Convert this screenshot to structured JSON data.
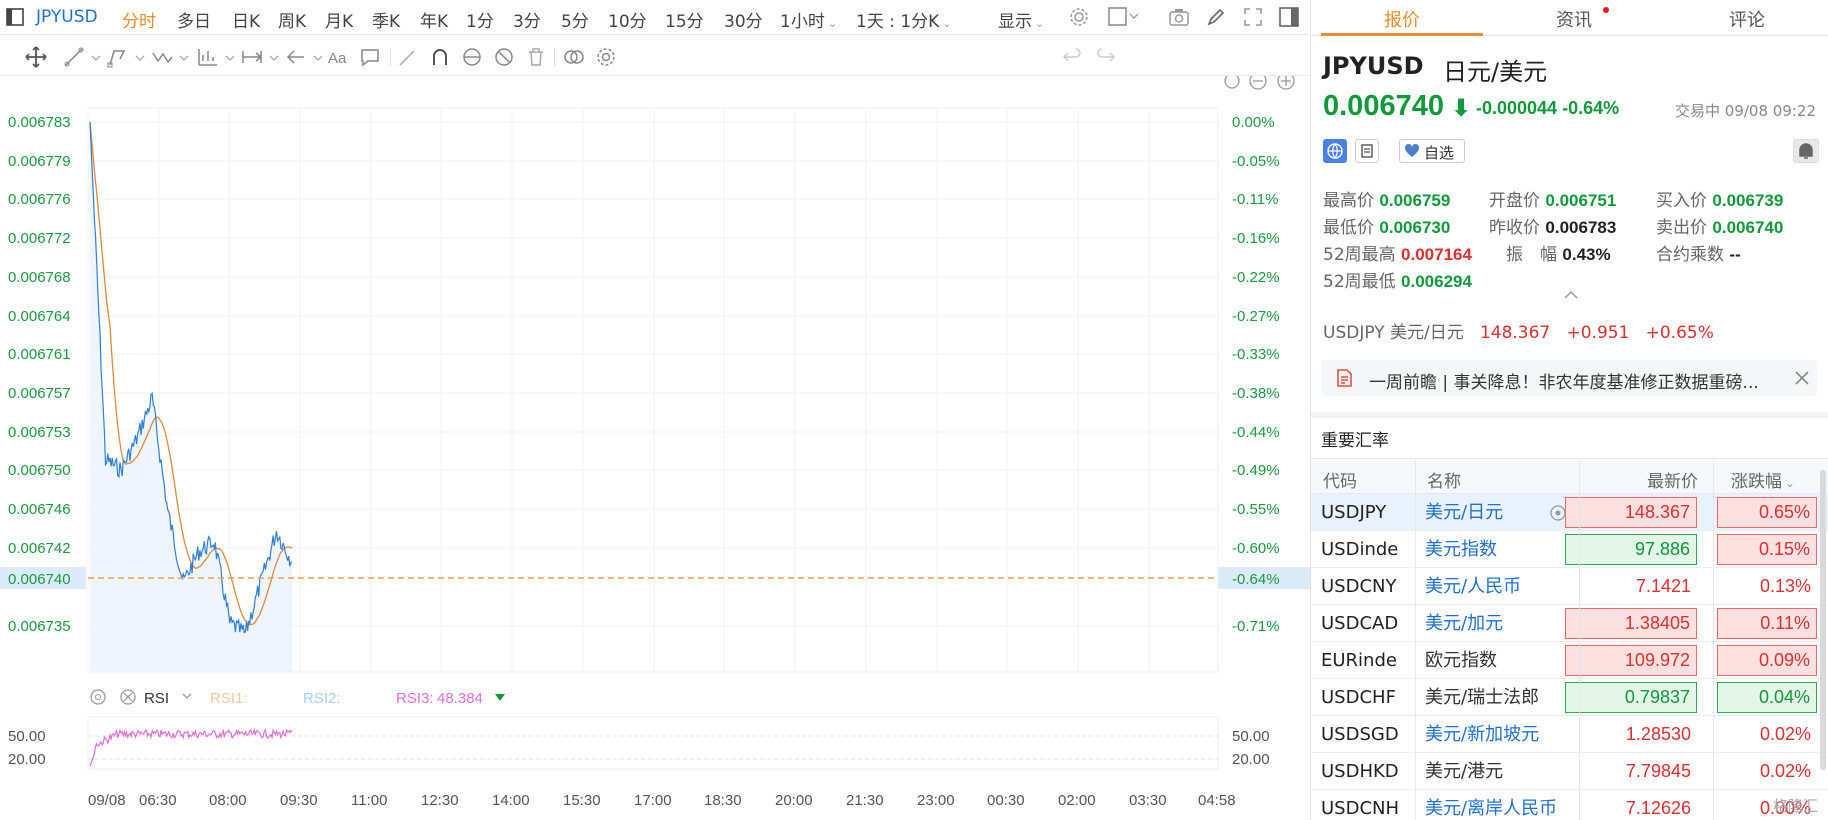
{
  "toolbar": {
    "symbol": "JPYUSD",
    "periods": [
      "分时",
      "多日",
      "日K",
      "周K",
      "月K",
      "季K",
      "年K",
      "1分",
      "3分",
      "5分",
      "10分",
      "15分",
      "30分",
      "1小时",
      "1天 : 1分K"
    ],
    "active_period": "分时",
    "display_label": "显示"
  },
  "chart": {
    "y_labels": [
      "0.006783",
      "0.006779",
      "0.006776",
      "0.006772",
      "0.006768",
      "0.006764",
      "0.006761",
      "0.006757",
      "0.006753",
      "0.006750",
      "0.006746",
      "0.006742",
      "0.006735"
    ],
    "current_price_label": "0.006740",
    "pct_labels": [
      "0.00%",
      "-0.05%",
      "-0.11%",
      "-0.16%",
      "-0.22%",
      "-0.27%",
      "-0.33%",
      "-0.38%",
      "-0.44%",
      "-0.49%",
      "-0.55%",
      "-0.60%",
      "-0.71%"
    ],
    "current_pct_label": "-0.64%",
    "x_labels": [
      "09/08",
      "06:30",
      "08:00",
      "09:30",
      "11:00",
      "12:30",
      "14:00",
      "15:30",
      "17:00",
      "18:30",
      "20:00",
      "21:30",
      "23:00",
      "00:30",
      "02:00",
      "03:30",
      "04:58"
    ],
    "rsi": {
      "name": "RSI",
      "rsi1": "RSI1:",
      "rsi2": "RSI2:",
      "rsi3_label": "RSI3:",
      "rsi3_value": "48.384",
      "levels": [
        "50.00",
        "20.00"
      ]
    },
    "colors": {
      "price_line": "#2f7fd8",
      "ma_line": "#e0893a",
      "rsi_line": "#e070d8",
      "up": "#e02e2e",
      "down": "#119a3a"
    }
  },
  "chart_data": {
    "type": "line",
    "title": "",
    "xlabel": "",
    "ylabel": "",
    "ylim": [
      0.006731,
      0.006783
    ],
    "x": [
      "05:00",
      "05:20",
      "05:40",
      "06:00",
      "06:20",
      "06:40",
      "07:00",
      "07:20",
      "07:40",
      "08:00",
      "08:20",
      "08:40",
      "09:00",
      "09:20"
    ],
    "series": [
      {
        "values": [
          0.006783,
          0.00675,
          0.006749,
          0.006752,
          0.006756,
          0.006745,
          0.006738,
          0.006741,
          0.006742,
          0.006734,
          0.006733,
          0.006738,
          0.006743,
          0.00674
        ]
      }
    ]
  },
  "panel": {
    "tabs": [
      "报价",
      "资讯",
      "评论"
    ],
    "symbol": "JPYUSD",
    "name_cn": "日元/美元",
    "price": "0.006740",
    "arrow": "⬇",
    "change": "-0.000044",
    "change_pct": "-0.64%",
    "status": "交易中 09/08 09:22",
    "watch_label": "自选",
    "stats": {
      "high_label": "最高价",
      "high": "0.006759",
      "open_label": "开盘价",
      "open": "0.006751",
      "bid_label": "买入价",
      "bid": "0.006739",
      "low_label": "最低价",
      "low": "0.006730",
      "prev_label": "昨收价",
      "prev": "0.006783",
      "ask_label": "卖出价",
      "ask": "0.006740",
      "wk52h_label": "52周最高",
      "wk52h": "0.007164",
      "amp_label": "振　幅",
      "amp": "0.43%",
      "mult_label": "合约乘数",
      "mult": "--",
      "wk52l_label": "52周最低",
      "wk52l": "0.006294"
    },
    "related": {
      "name": "USDJPY 美元/日元",
      "price": "148.367",
      "chg": "+0.951",
      "pct": "+0.65%"
    },
    "news": "一周前瞻 | 事关降息！非农年度基准修正数据重磅...",
    "section_title": "重要汇率",
    "headers": {
      "code": "代码",
      "name": "名称",
      "price": "最新价",
      "pct": "涨跌幅"
    },
    "rows": [
      {
        "code": "USDJPY",
        "name": "美元/日元",
        "price": "148.367",
        "pct": "0.65%"
      },
      {
        "code": "USDinde",
        "name": "美元指数",
        "price": "97.886",
        "pct": "0.15%"
      },
      {
        "code": "USDCNY",
        "name": "美元/人民币",
        "price": "7.1421",
        "pct": "0.13%"
      },
      {
        "code": "USDCAD",
        "name": "美元/加元",
        "price": "1.38405",
        "pct": "0.11%"
      },
      {
        "code": "EURinde",
        "name": "欧元指数",
        "price": "109.972",
        "pct": "0.09%"
      },
      {
        "code": "USDCHF",
        "name": "美元/瑞士法郎",
        "price": "0.79837",
        "pct": "0.04%"
      },
      {
        "code": "USDSGD",
        "name": "美元/新加坡元",
        "price": "1.28530",
        "pct": "0.02%"
      },
      {
        "code": "USDHKD",
        "name": "美元/港元",
        "price": "7.79845",
        "pct": "0.02%"
      },
      {
        "code": "USDCNH",
        "name": "美元/离岸人民币",
        "price": "7.12626",
        "pct": "0.00%"
      }
    ],
    "watermark": "格隆汇"
  }
}
